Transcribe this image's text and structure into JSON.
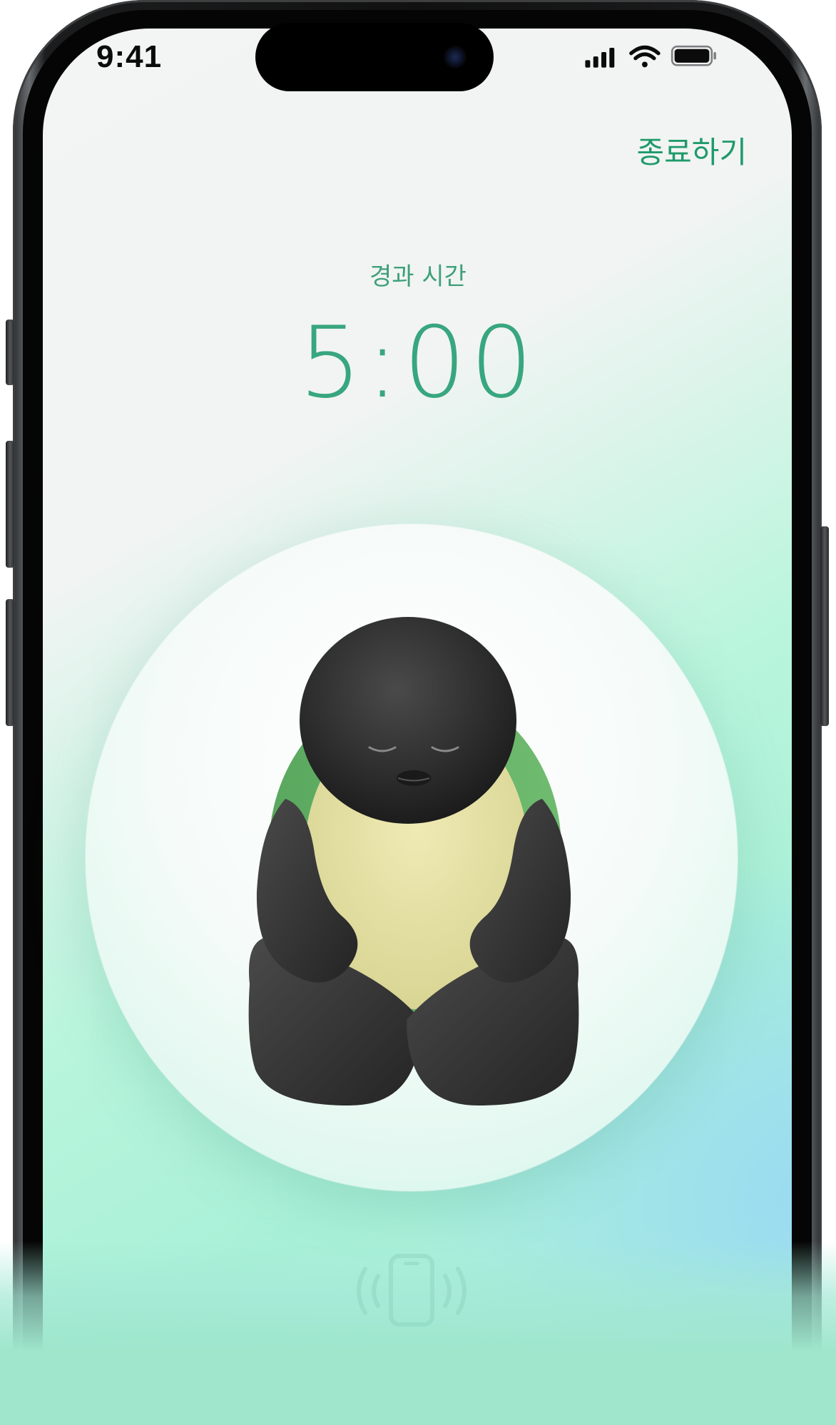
{
  "status_bar": {
    "time": "9:41",
    "icons": [
      "cellular-signal-icon",
      "wifi-icon",
      "battery-icon"
    ]
  },
  "header": {
    "end_label": "종료하기"
  },
  "timer": {
    "label": "경과 시간",
    "value": "5:00"
  },
  "mascot": {
    "icon": "meditating-turtle-illustration"
  },
  "footer": {
    "icon": "phone-vibrate-icon"
  },
  "colors": {
    "accent": "#38a67f",
    "end_button": "#1f9a6b",
    "background_mint": "#a9f0d8"
  }
}
